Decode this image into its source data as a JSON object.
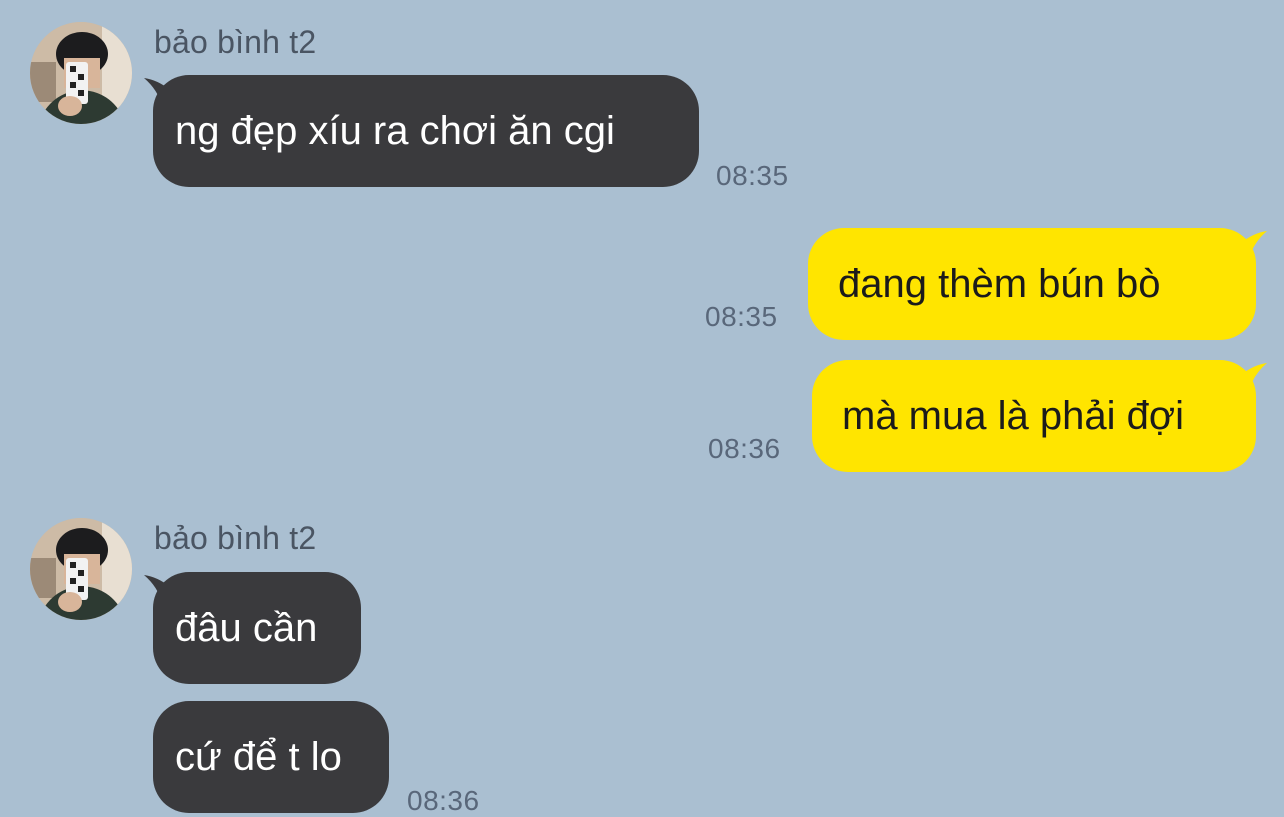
{
  "colors": {
    "background": "#aabfd1",
    "incoming_bubble": "#3a3a3d",
    "outgoing_bubble": "#ffe500"
  },
  "groups": [
    {
      "sender": "bảo bình t2",
      "avatar_icon": "contact-avatar-photo",
      "messages": [
        {
          "text": "ng đẹp xíu ra chơi ăn cgi",
          "time": "08:35"
        }
      ]
    },
    {
      "sender": "me",
      "messages": [
        {
          "text": "đang thèm bún bò",
          "time": "08:35"
        },
        {
          "text": "mà mua là phải đợi",
          "time": "08:36"
        }
      ]
    },
    {
      "sender": "bảo bình t2",
      "avatar_icon": "contact-avatar-photo",
      "messages": [
        {
          "text": "đâu cần",
          "time": ""
        },
        {
          "text": "cứ để t lo",
          "time": "08:36"
        }
      ]
    }
  ]
}
